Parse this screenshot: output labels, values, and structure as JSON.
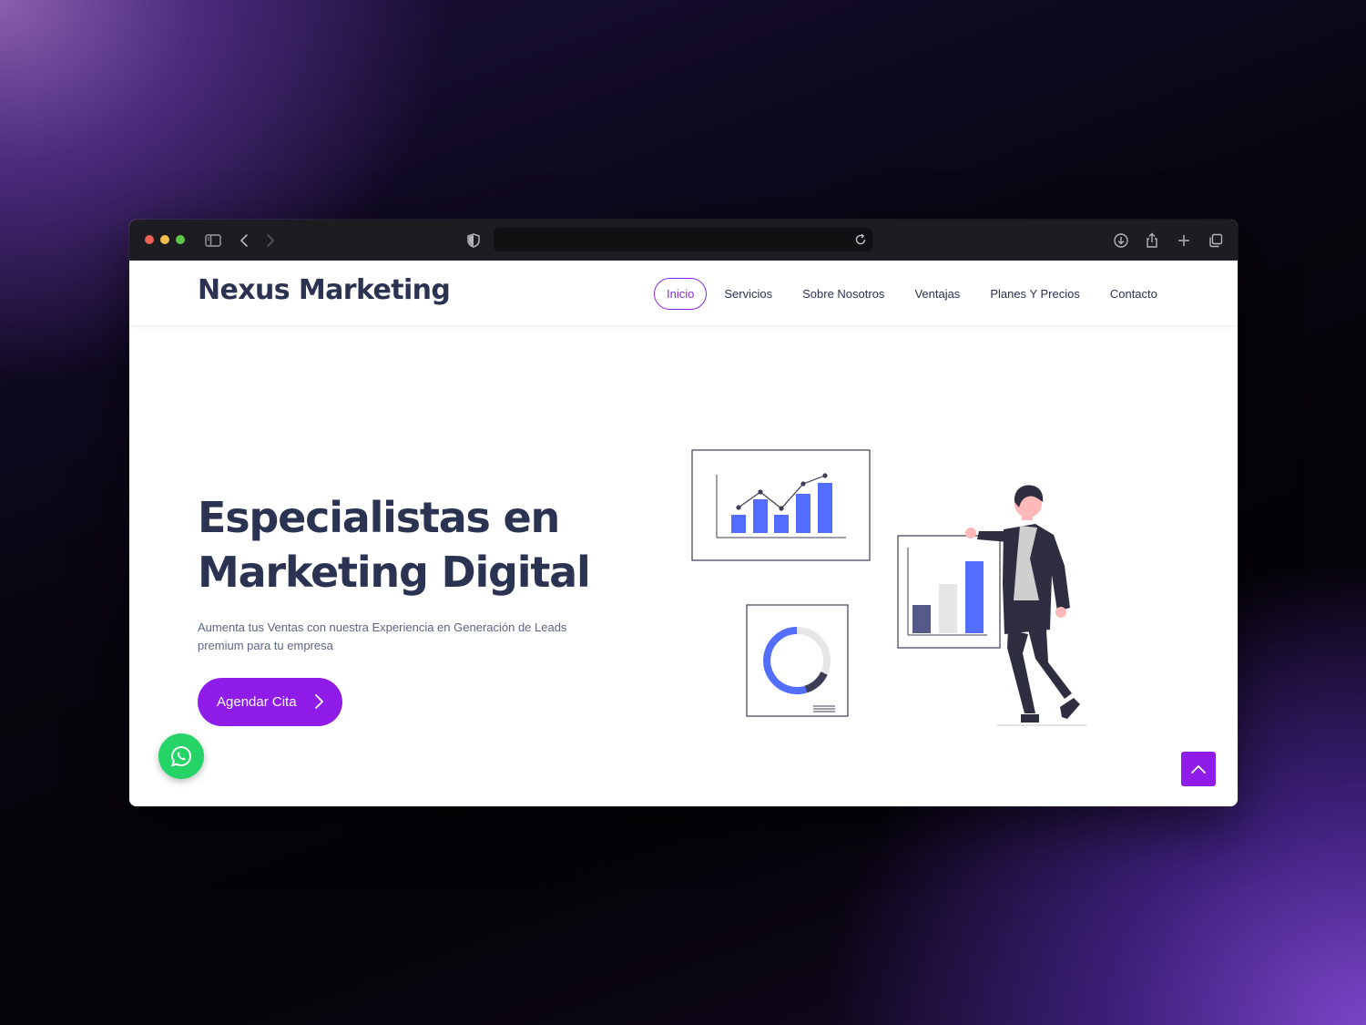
{
  "browser": {
    "url": "",
    "buttons": [
      "sidebar-toggle",
      "back",
      "forward",
      "shield",
      "reload",
      "downloads",
      "share",
      "new-tab",
      "tab-overview"
    ]
  },
  "site": {
    "brand": "Nexus Marketing",
    "nav": [
      {
        "label": "Inicio",
        "active": true
      },
      {
        "label": "Servicios",
        "active": false
      },
      {
        "label": "Sobre Nosotros",
        "active": false
      },
      {
        "label": "Ventajas",
        "active": false
      },
      {
        "label": "Planes Y Precios",
        "active": false
      },
      {
        "label": "Contacto",
        "active": false
      }
    ]
  },
  "hero": {
    "title_line1": "Especialistas en",
    "title_line2": "Marketing Digital",
    "subtitle_line1": "Aumenta tus Ventas con nuestra Experiencia en Generación de Leads",
    "subtitle_line2": "premium para tu empresa",
    "cta_label": "Agendar Cita"
  },
  "floating": {
    "whatsapp_icon": "whatsapp-icon",
    "back_to_top_icon": "chevron-up-icon"
  },
  "colors": {
    "accent": "#8f1ce8",
    "heading": "#2b3252",
    "chart_blue": "#536dfe",
    "whatsapp": "#25d366"
  }
}
